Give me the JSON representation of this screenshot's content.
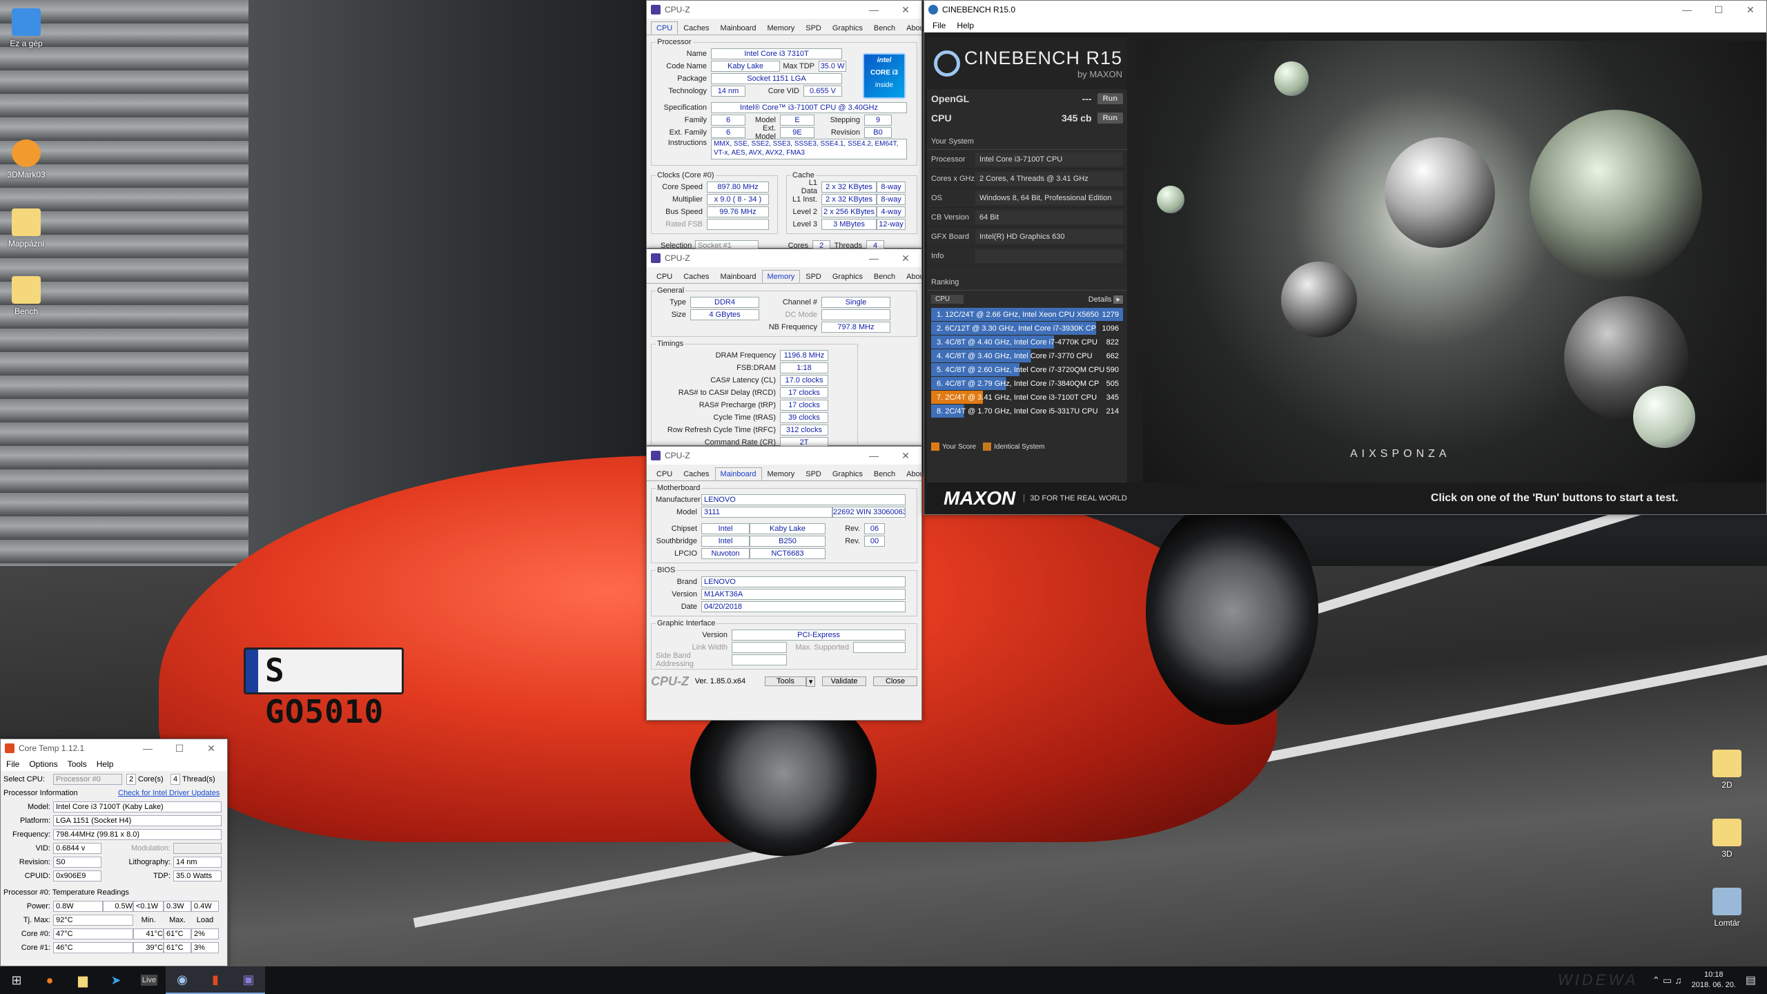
{
  "desktop_icons": [
    {
      "label": "Ez a gép",
      "color": "#3d8fe6"
    },
    {
      "label": "3DMark03",
      "color": "#f29a2e"
    },
    {
      "label": "Mappázni",
      "color": "#f5d77c"
    },
    {
      "label": "Bench",
      "color": "#f5d77c"
    },
    {
      "label": "2D",
      "color": "#f5d77c"
    },
    {
      "label": "3D",
      "color": "#f5d77c"
    },
    {
      "label": "Lomtár",
      "color": "#9ab9d8"
    }
  ],
  "plate": "S GO5010",
  "cpuz1": {
    "title": "CPU-Z",
    "tabs": [
      "CPU",
      "Caches",
      "Mainboard",
      "Memory",
      "SPD",
      "Graphics",
      "Bench",
      "About"
    ],
    "processor_legend": "Processor",
    "name_lbl": "Name",
    "name": "Intel Core i3 7310T",
    "code_lbl": "Code Name",
    "code": "Kaby Lake",
    "tdp_lbl": "Max TDP",
    "tdp": "35.0 W",
    "pkg_lbl": "Package",
    "pkg": "Socket 1151 LGA",
    "tech_lbl": "Technology",
    "tech": "14 nm",
    "vid_lbl": "Core VID",
    "vid": "0.655 V",
    "spec_lbl": "Specification",
    "spec": "Intel® Core™ i3-7100T CPU @ 3.40GHz",
    "fam_lbl": "Family",
    "fam": "6",
    "model_lbl": "Model",
    "model": "E",
    "step_lbl": "Stepping",
    "step": "9",
    "extfam_lbl": "Ext. Family",
    "extfam": "6",
    "extmodel_lbl": "Ext. Model",
    "extmodel": "9E",
    "rev_lbl": "Revision",
    "rev": "B0",
    "instr_lbl": "Instructions",
    "instr": "MMX, SSE, SSE2, SSE3, SSSE3, SSE4.1, SSE4.2, EM64T, VT-x, AES, AVX, AVX2, FMA3",
    "clocks_legend": "Clocks (Core #0)",
    "cs_lbl": "Core Speed",
    "cs": "897.80 MHz",
    "mult_lbl": "Multiplier",
    "mult": "x 9.0 ( 8 - 34 )",
    "bus_lbl": "Bus Speed",
    "bus": "99.76 MHz",
    "fsb_lbl": "Rated FSB",
    "cache_legend": "Cache",
    "l1d_lbl": "L1 Data",
    "l1d": "2 x 32 KBytes",
    "l1d_w": "8-way",
    "l1i_lbl": "L1 Inst.",
    "l1i": "2 x 32 KBytes",
    "l1i_w": "8-way",
    "l2_lbl": "Level 2",
    "l2": "2 x 256 KBytes",
    "l2_w": "4-way",
    "l3_lbl": "Level 3",
    "l3": "3 MBytes",
    "l3_w": "12-way",
    "sel_lbl": "Selection",
    "sel": "Socket #1",
    "cores_lbl": "Cores",
    "cores": "2",
    "threads_lbl": "Threads",
    "threads": "4",
    "badge_top": "intel",
    "badge_mid": "CORE i3",
    "badge_bot": "inside"
  },
  "cpuz2": {
    "title": "CPU-Z",
    "general_legend": "General",
    "type_lbl": "Type",
    "type": "DDR4",
    "size_lbl": "Size",
    "size": "4 GBytes",
    "ch_lbl": "Channel #",
    "ch": "Single",
    "dc_lbl": "DC Mode",
    "nb_lbl": "NB Frequency",
    "nb": "797.8 MHz",
    "timings_legend": "Timings",
    "t": [
      [
        "DRAM Frequency",
        "1196.8 MHz"
      ],
      [
        "FSB:DRAM",
        "1:18"
      ],
      [
        "CAS# Latency (CL)",
        "17.0 clocks"
      ],
      [
        "RAS# to CAS# Delay (tRCD)",
        "17 clocks"
      ],
      [
        "RAS# Precharge (tRP)",
        "17 clocks"
      ],
      [
        "Cycle Time (tRAS)",
        "39 clocks"
      ],
      [
        "Row Refresh Cycle Time (tRFC)",
        "312 clocks"
      ],
      [
        "Command Rate (CR)",
        "2T"
      ]
    ]
  },
  "cpuz3": {
    "title": "CPU-Z",
    "mb_legend": "Motherboard",
    "man_lbl": "Manufacturer",
    "man": "LENOVO",
    "model_lbl": "Model",
    "model": "3111",
    "model2": "22692 WIN 33060063",
    "chip_lbl": "Chipset",
    "chip1": "Intel",
    "chip2": "Kaby Lake",
    "rev_lbl": "Rev.",
    "chiprev": "06",
    "sb_lbl": "Southbridge",
    "sb1": "Intel",
    "sb2": "B250",
    "sbrev": "00",
    "lpc_lbl": "LPCIO",
    "lpc1": "Nuvoton",
    "lpc2": "NCT6683",
    "bios_legend": "BIOS",
    "brand_lbl": "Brand",
    "brand": "LENOVO",
    "ver_lbl": "Version",
    "ver": "M1AKT36A",
    "date_lbl": "Date",
    "date": "04/20/2018",
    "gi_legend": "Graphic Interface",
    "giv_lbl": "Version",
    "giv": "PCI-Express",
    "lw_lbl": "Link Width",
    "ms_lbl": "Max. Supported",
    "sba_lbl": "Side Band Addressing",
    "logo": "CPU-Z",
    "verstr": "Ver. 1.85.0.x64",
    "tools": "Tools",
    "validate": "Validate",
    "close": "Close"
  },
  "cb": {
    "title": "CINEBENCH R15.0",
    "menu": [
      "File",
      "Help"
    ],
    "brand": "CINEBENCH R15",
    "by": "by MAXON",
    "opengl_lbl": "OpenGL",
    "opengl": "---",
    "cpu_lbl": "CPU",
    "cpu": "345 cb",
    "run": "Run",
    "sys_hdr": "Your System",
    "sys": [
      [
        "Processor",
        "Intel Core i3-7100T CPU"
      ],
      [
        "Cores x GHz",
        "2 Cores, 4 Threads @ 3.41 GHz"
      ],
      [
        "OS",
        "Windows 8, 64 Bit, Professional Edition"
      ],
      [
        "CB Version",
        "64 Bit"
      ],
      [
        "GFX Board",
        "Intel(R) HD Graphics 630"
      ],
      [
        "Info",
        ""
      ]
    ],
    "rank_hdr": "Ranking",
    "rank_sel": "CPU",
    "details": "Details",
    "ranks": [
      [
        "1. 12C/24T @ 2.66 GHz, Intel Xeon CPU X5650",
        "1279"
      ],
      [
        "2. 6C/12T @ 3.30 GHz,  Intel Core i7-3930K CP",
        "1096"
      ],
      [
        "3. 4C/8T @ 4.40 GHz, Intel Core i7-4770K CPU",
        "822"
      ],
      [
        "4. 4C/8T @ 3.40 GHz,  Intel Core i7-3770 CPU",
        "662"
      ],
      [
        "5. 4C/8T @ 2.60 GHz, Intel Core i7-3720QM CPU",
        "590"
      ],
      [
        "6. 4C/8T @ 2.79 GHz,  Intel Core i7-3840QM CP",
        "505"
      ],
      [
        "7. 2C/4T @ 3.41 GHz, Intel Core i3-7100T CPU",
        "345"
      ],
      [
        "8. 2C/4T @ 1.70 GHz,  Intel Core i5-3317U CPU",
        "214"
      ]
    ],
    "your_score": "Your Score",
    "identical": "Identical System",
    "maxon": "MAXON",
    "tagline": "3D FOR THE REAL WORLD",
    "hint": "Click on one of the 'Run' buttons to start a test.",
    "watermark": "AIXSPONZA"
  },
  "ct": {
    "title": "Core Temp 1.12.1",
    "menu": [
      "File",
      "Options",
      "Tools",
      "Help"
    ],
    "sel_lbl": "Select CPU:",
    "sel": "Processor #0",
    "cores": "2",
    "cores_lbl": "Core(s)",
    "threads": "4",
    "threads_lbl": "Thread(s)",
    "pi_lbl": "Processor Information",
    "link": "Check for Intel Driver Updates",
    "model_lbl": "Model:",
    "model": "Intel Core i3 7100T (Kaby Lake)",
    "plat_lbl": "Platform:",
    "plat": "LGA 1151 (Socket H4)",
    "freq_lbl": "Frequency:",
    "freq": "798.44MHz (99.81 x 8.0)",
    "vid_lbl": "VID:",
    "vid": "0.6844 v",
    "mod_lbl": "Modulation:",
    "rev_lbl": "Revision:",
    "rev": "S0",
    "lith_lbl": "Lithography:",
    "lith": "14 nm",
    "cpuid_lbl": "CPUID:",
    "cpuid": "0x906E9",
    "tdp_lbl": "TDP:",
    "tdp": "35.0 Watts",
    "tr_lbl": "Processor #0: Temperature Readings",
    "power_lbl": "Power:",
    "p": [
      "0.8W",
      "0.5W",
      "<0.1W",
      "0.3W",
      "0.4W"
    ],
    "tj_lbl": "Tj. Max:",
    "tj": "92°C",
    "min": "Min.",
    "max": "Max.",
    "load": "Load",
    "c0_lbl": "Core #0:",
    "c0": [
      "47°C",
      "41°C",
      "61°C",
      "2%"
    ],
    "c1_lbl": "Core #1:",
    "c1": [
      "46°C",
      "39°C",
      "61°C",
      "3%"
    ]
  },
  "taskbar": {
    "time": "10:18",
    "date": "2018. 06. 20.",
    "watermark": "WIDEWA"
  }
}
